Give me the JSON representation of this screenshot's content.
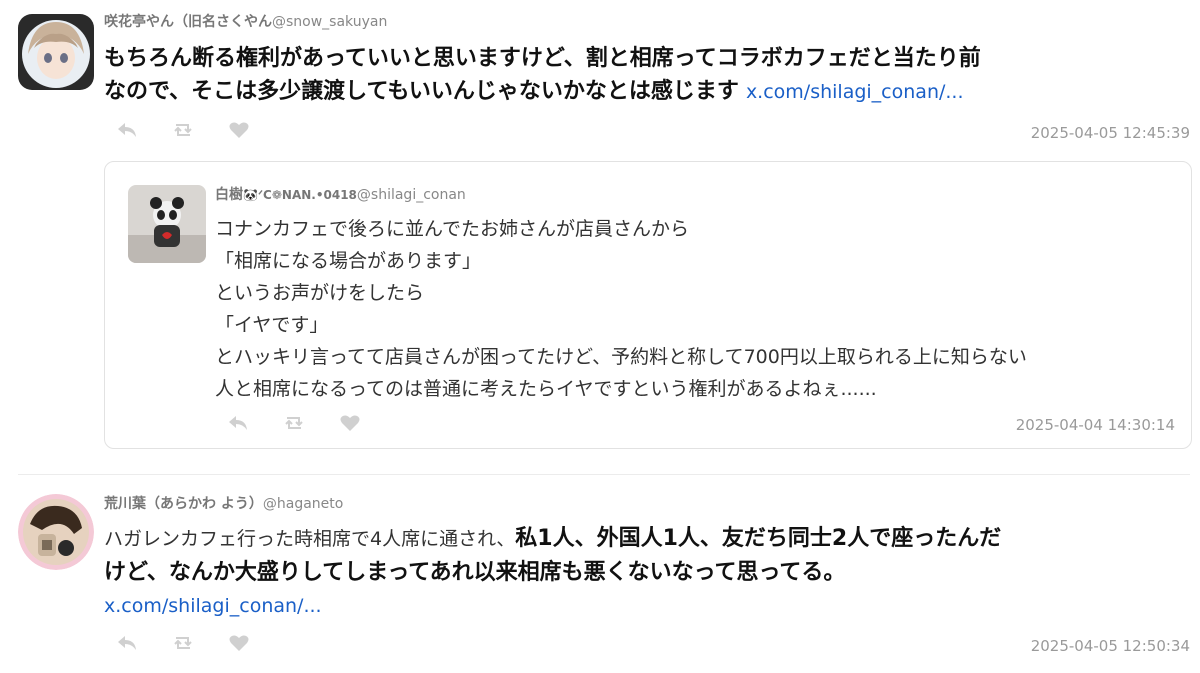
{
  "tweets": [
    {
      "display_name": "咲花亭やん（旧名さくやん",
      "handle": "@snow_sakuyan",
      "text_line1": "もちろん断る権利があっていいと思いますけど、割と相席ってコラボカフェだと当たり前",
      "text_line2": "なので、そこは多少譲渡してもいいんじゃないかなとは感じます",
      "link": "x.com/shilagi_conan/...",
      "timestamp": "2025-04-05 12:45:39"
    },
    {
      "display_name": "荒川葉（あらかわ よう）",
      "handle": "@haganeto",
      "text_plain": "ハガレンカフェ行った時相席で4人席に通され、",
      "text_bold1": "私1人、外国人1人、友だち同士2人で座ったんだ",
      "text_bold2": "けど、なんか大盛りしてしまってあれ以来相席も悪くないなって思ってる。",
      "link": "x.com/shilagi_conan/...",
      "timestamp": "2025-04-05 12:50:34"
    }
  ],
  "quote": {
    "display_name": "白樹",
    "name_deco": "🐼ᐟC❁NAN.•0418",
    "handle": "@shilagi_conan",
    "lines": [
      "コナンカフェで後ろに並んでたお姉さんが店員さんから",
      "「相席になる場合があります」",
      "というお声がけをしたら",
      "「イヤです」",
      "とハッキリ言ってて店員さんが困ってたけど、予約料と称して700円以上取られる上に知らない",
      "人と相席になるってのは普通に考えたらイヤですという権利があるよねぇ......"
    ],
    "timestamp": "2025-04-04 14:30:14"
  },
  "icons": {
    "reply": "reply-icon",
    "retweet": "retweet-icon",
    "like": "heart-icon"
  },
  "colors": {
    "link": "#1a5fc7",
    "muted": "#9a9a9a",
    "icon": "#d0d0d0"
  }
}
